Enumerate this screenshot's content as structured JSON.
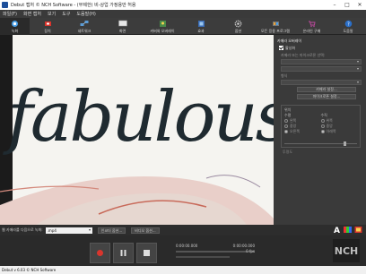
{
  "window": {
    "title": "Debut 캡처 © NCH Software - (무제한) 비-상업 가정용만 허용",
    "minimize": "–",
    "maximize": "□",
    "close": "✕"
  },
  "menubar": [
    "파일(F)",
    "화면 캡처",
    "보기",
    "도구",
    "도움말(H)"
  ],
  "toolbar": [
    {
      "name": "record",
      "label": "녹화",
      "icon": "record-icon",
      "active": true
    },
    {
      "name": "video",
      "label": "장치",
      "icon": "device-icon"
    },
    {
      "name": "network",
      "label": "네트워크",
      "icon": "network-icon"
    },
    {
      "name": "screen",
      "label": "화면",
      "icon": "screen-icon"
    },
    {
      "name": "overlay",
      "label": "커버와 오버레이",
      "icon": "overlay-icon"
    },
    {
      "name": "effects",
      "label": "효과",
      "icon": "effects-icon"
    },
    {
      "name": "options",
      "label": "옵션",
      "icon": "gear-icon"
    },
    {
      "name": "suite",
      "label": "모든 응용 프로그램",
      "icon": "suite-icon"
    },
    {
      "name": "buy",
      "label": "온라인 구매",
      "icon": "cart-icon"
    },
    {
      "name": "help",
      "label": "도움말",
      "icon": "help-icon"
    }
  ],
  "side": {
    "header": "카메라 오버레이",
    "enable": "활성화",
    "camera_label": "카메라 또는 마이크로폰 선택:",
    "format_label": "형식",
    "settings_button": "카메라 설정...",
    "mic_button": "마이크로폰 설정...",
    "position_title": "위치",
    "horizontal": "수평",
    "vertical": "수직",
    "h_options": [
      "왼쪽",
      "중앙",
      "오른쪽"
    ],
    "v_options": [
      "위쪽",
      "중앙",
      "아래쪽"
    ],
    "h_selected": 2,
    "v_selected": 2,
    "blend": "투명도",
    "slider_level": 0.75
  },
  "controlbar": {
    "capture_label": "웹 카메라를 다음으로 녹화:",
    "format": ".mp4",
    "encoder_button": "인코더 옵션...",
    "video_button": "비디오 옵션..."
  },
  "transport": {
    "time_elapsed": "0:00:00.000",
    "time_total": "0:00:00.000",
    "fps": "0 fps"
  },
  "status": "Debut v 6.03 © NCH Software",
  "colors": {
    "record_red": "#d9352d",
    "toolbar_bg": "#3c3c3c"
  }
}
